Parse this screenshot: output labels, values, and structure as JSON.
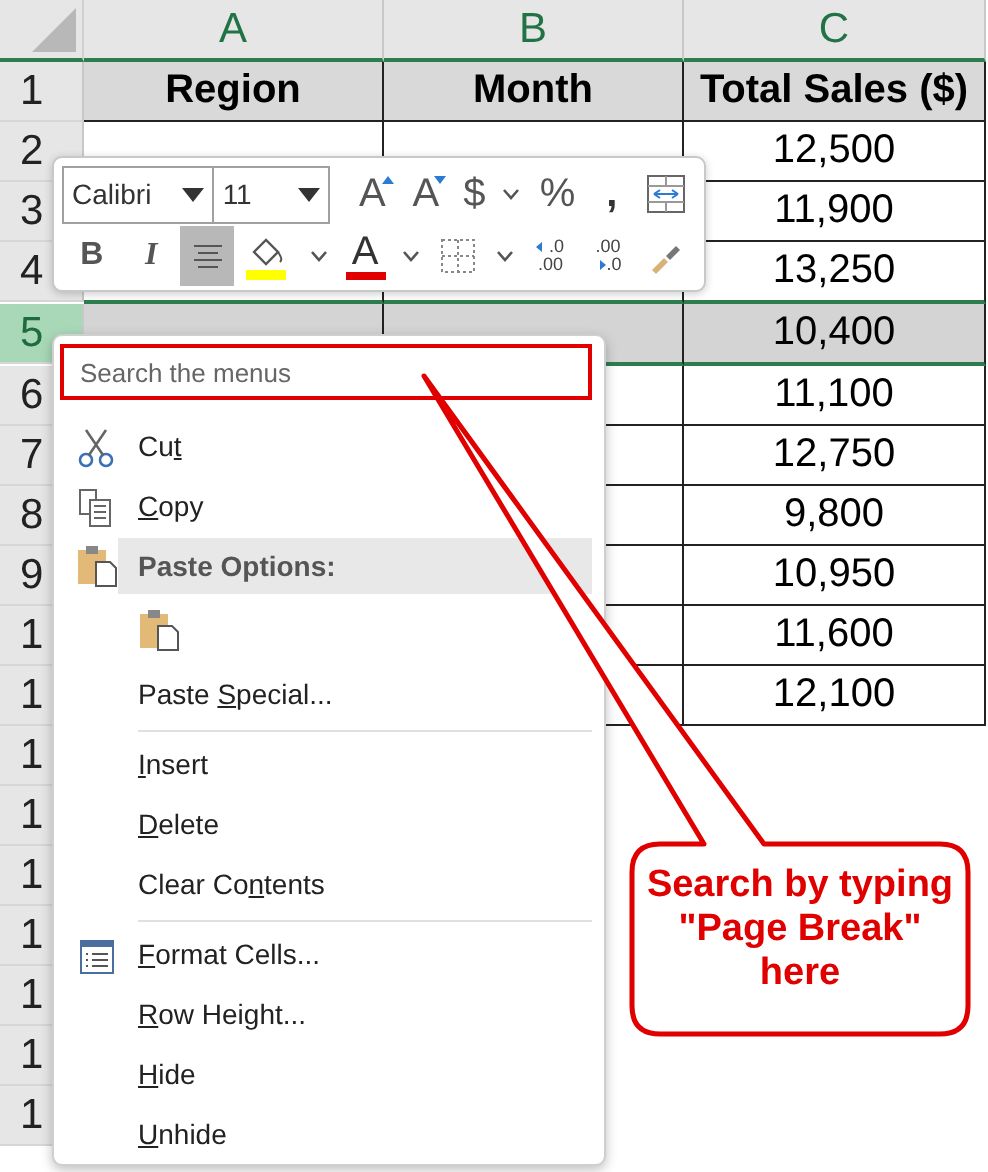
{
  "sheet": {
    "columns": [
      {
        "label": "A"
      },
      {
        "label": "B"
      },
      {
        "label": "C"
      }
    ],
    "rows": [
      {
        "number": "1",
        "kind": "header",
        "selected": false,
        "a": "Region",
        "b": "Month",
        "c": "Total Sales ($)"
      },
      {
        "number": "2",
        "kind": "data",
        "selected": false,
        "c": "12,500"
      },
      {
        "number": "3",
        "kind": "data",
        "selected": false,
        "c": "11,900"
      },
      {
        "number": "4",
        "kind": "data",
        "selected": false,
        "c": "13,250"
      },
      {
        "number": "5",
        "kind": "data",
        "selected": true,
        "c": "10,400"
      },
      {
        "number": "6",
        "kind": "data",
        "selected": false,
        "c": "11,100"
      },
      {
        "number": "7",
        "kind": "data",
        "selected": false,
        "c": "12,750"
      },
      {
        "number": "8",
        "kind": "data",
        "selected": false,
        "c": "9,800"
      },
      {
        "number": "9",
        "kind": "data",
        "selected": false,
        "c": "10,950"
      },
      {
        "number": "1",
        "kind": "data",
        "selected": false,
        "c": "11,600"
      },
      {
        "number": "1",
        "kind": "data",
        "selected": false,
        "c": "12,100"
      },
      {
        "number": "1",
        "kind": "empty",
        "selected": false
      },
      {
        "number": "1",
        "kind": "empty",
        "selected": false
      },
      {
        "number": "1",
        "kind": "empty",
        "selected": false
      },
      {
        "number": "1",
        "kind": "empty",
        "selected": false
      },
      {
        "number": "1",
        "kind": "empty",
        "selected": false
      },
      {
        "number": "1",
        "kind": "empty",
        "selected": false
      },
      {
        "number": "1",
        "kind": "empty",
        "selected": false
      }
    ]
  },
  "mini_toolbar": {
    "font": "Calibri",
    "size": "11",
    "row_1": [
      {
        "kind": "grow-font",
        "label": "A"
      },
      {
        "kind": "shrink-font",
        "label": "A"
      },
      {
        "kind": "currency",
        "label": "$"
      },
      {
        "kind": "dropdown"
      },
      {
        "kind": "percent",
        "label": "%"
      },
      {
        "kind": "comma",
        "label": ","
      },
      {
        "kind": "wrap"
      }
    ],
    "row_2": [
      {
        "kind": "bold",
        "label": "B",
        "selected": false
      },
      {
        "kind": "italic",
        "label": "I",
        "selected": false
      },
      {
        "kind": "align-center",
        "selected": true
      },
      {
        "kind": "fill-color",
        "color": "#ffff00",
        "selected": false
      },
      {
        "kind": "dropdown",
        "selected": false
      },
      {
        "kind": "font-color",
        "label": "A",
        "color": "#e00000",
        "selected": false
      },
      {
        "kind": "dropdown",
        "selected": false
      },
      {
        "kind": "borders",
        "selected": false
      },
      {
        "kind": "dropdown",
        "selected": false
      },
      {
        "kind": "increase-decimal",
        "lines": [
          ".0",
          ".00"
        ],
        "selected": false
      },
      {
        "kind": "decrease-decimal",
        "lines": [
          ".00",
          ".0"
        ],
        "selected": false
      },
      {
        "kind": "format-painter",
        "selected": false
      }
    ]
  },
  "context_menu": {
    "search": {
      "placeholder": "Search the menus"
    },
    "items": [
      {
        "kind": "cut",
        "parts": [
          {
            "text": "Cu"
          },
          {
            "text": "t",
            "access_key": true
          }
        ]
      },
      {
        "kind": "copy",
        "parts": [
          {
            "text": "C",
            "access_key": true
          },
          {
            "text": "opy"
          }
        ]
      },
      {
        "kind": "section",
        "parts": [
          {
            "text": "Paste Options:"
          }
        ]
      },
      {
        "kind": "paste-option"
      },
      {
        "kind": "item",
        "parts": [
          {
            "text": "Paste "
          },
          {
            "text": "S",
            "access_key": true
          },
          {
            "text": "pecial..."
          }
        ]
      },
      {
        "kind": "separator"
      },
      {
        "kind": "item",
        "parts": [
          {
            "text": "I",
            "access_key": true
          },
          {
            "text": "nsert"
          }
        ]
      },
      {
        "kind": "item",
        "parts": [
          {
            "text": "D",
            "access_key": true
          },
          {
            "text": "elete"
          }
        ]
      },
      {
        "kind": "item",
        "parts": [
          {
            "text": "Clear Co"
          },
          {
            "text": "n",
            "access_key": true
          },
          {
            "text": "tents"
          }
        ]
      },
      {
        "kind": "separator"
      },
      {
        "kind": "format",
        "parts": [
          {
            "text": "F",
            "access_key": true
          },
          {
            "text": "ormat Cells..."
          }
        ]
      },
      {
        "kind": "item",
        "parts": [
          {
            "text": "R",
            "access_key": true
          },
          {
            "text": "ow Height..."
          }
        ]
      },
      {
        "kind": "item",
        "parts": [
          {
            "text": "H",
            "access_key": true
          },
          {
            "text": "ide"
          }
        ]
      },
      {
        "kind": "item",
        "parts": [
          {
            "text": "U",
            "access_key": true
          },
          {
            "text": "nhide"
          }
        ]
      }
    ]
  },
  "callout": {
    "text": "Search by typing \"Page Break\" here"
  }
}
